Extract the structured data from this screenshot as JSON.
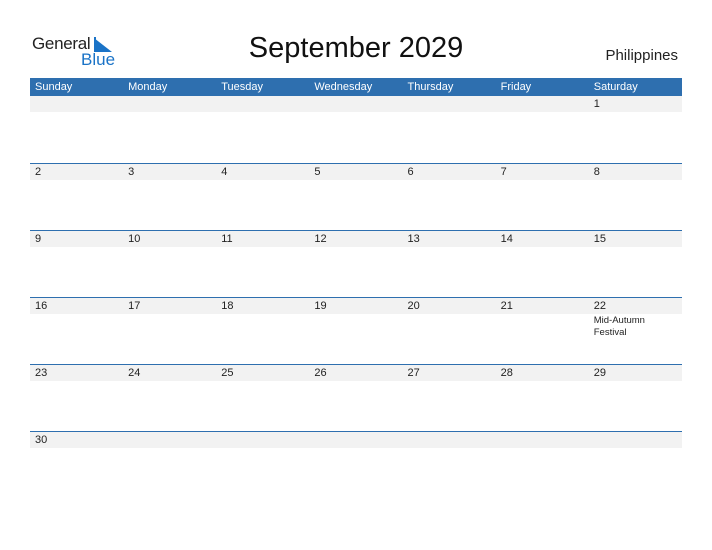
{
  "logo": {
    "line1": "General",
    "line2": "Blue"
  },
  "title": "September 2029",
  "country": "Philippines",
  "colors": {
    "header": "#2e6faf",
    "strip": "#f2f2f2",
    "brand": "#1a73c7"
  },
  "weekdays": [
    "Sunday",
    "Monday",
    "Tuesday",
    "Wednesday",
    "Thursday",
    "Friday",
    "Saturday"
  ],
  "weeks": [
    [
      {
        "d": ""
      },
      {
        "d": ""
      },
      {
        "d": ""
      },
      {
        "d": ""
      },
      {
        "d": ""
      },
      {
        "d": ""
      },
      {
        "d": "1"
      }
    ],
    [
      {
        "d": "2"
      },
      {
        "d": "3"
      },
      {
        "d": "4"
      },
      {
        "d": "5"
      },
      {
        "d": "6"
      },
      {
        "d": "7"
      },
      {
        "d": "8"
      }
    ],
    [
      {
        "d": "9"
      },
      {
        "d": "10"
      },
      {
        "d": "11"
      },
      {
        "d": "12"
      },
      {
        "d": "13"
      },
      {
        "d": "14"
      },
      {
        "d": "15"
      }
    ],
    [
      {
        "d": "16"
      },
      {
        "d": "17"
      },
      {
        "d": "18"
      },
      {
        "d": "19"
      },
      {
        "d": "20"
      },
      {
        "d": "21"
      },
      {
        "d": "22",
        "event": "Mid-Autumn Festival"
      }
    ],
    [
      {
        "d": "23"
      },
      {
        "d": "24"
      },
      {
        "d": "25"
      },
      {
        "d": "26"
      },
      {
        "d": "27"
      },
      {
        "d": "28"
      },
      {
        "d": "29"
      }
    ],
    [
      {
        "d": "30"
      },
      {
        "d": ""
      },
      {
        "d": ""
      },
      {
        "d": ""
      },
      {
        "d": ""
      },
      {
        "d": ""
      },
      {
        "d": ""
      }
    ]
  ]
}
